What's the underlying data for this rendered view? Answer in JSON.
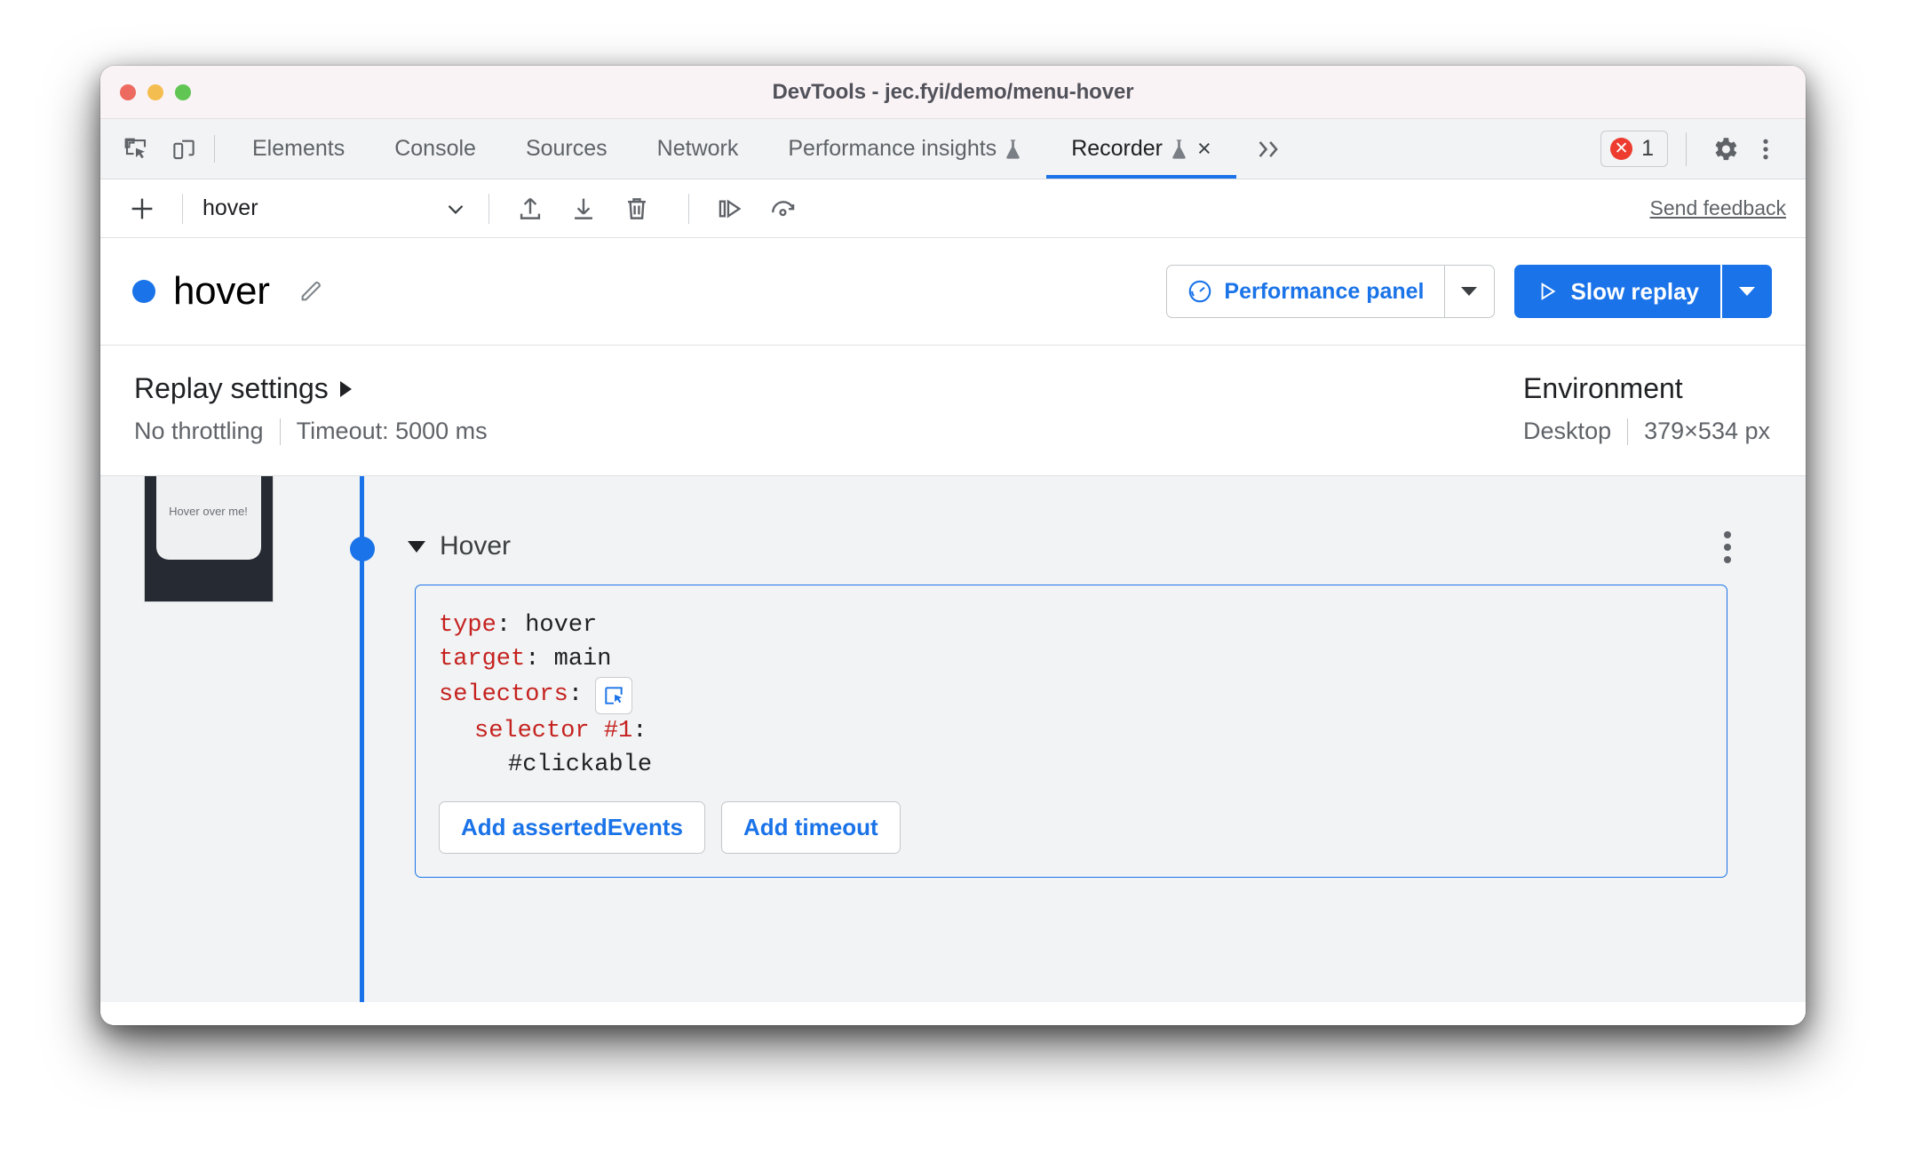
{
  "window": {
    "title": "DevTools - jec.fyi/demo/menu-hover",
    "traffic_lights": [
      "close",
      "minimize",
      "maximize"
    ]
  },
  "tabbar": {
    "left_icons": [
      "inspect-element-icon",
      "device-toolbar-icon"
    ],
    "tabs": [
      {
        "label": "Elements",
        "active": false,
        "experimental": false,
        "closable": false
      },
      {
        "label": "Console",
        "active": false,
        "experimental": false,
        "closable": false
      },
      {
        "label": "Sources",
        "active": false,
        "experimental": false,
        "closable": false
      },
      {
        "label": "Network",
        "active": false,
        "experimental": false,
        "closable": false
      },
      {
        "label": "Performance insights",
        "active": false,
        "experimental": true,
        "closable": false
      },
      {
        "label": "Recorder",
        "active": true,
        "experimental": true,
        "closable": true
      }
    ],
    "more_tabs_label": "»",
    "error_count": "1",
    "right_icons": [
      "settings-gear-icon",
      "kebab-menu-icon"
    ]
  },
  "recorder_toolbar": {
    "add_label": "+",
    "selected_recording": "hover",
    "icons": [
      "import-icon",
      "export-icon",
      "delete-icon",
      "step-over-icon",
      "replay-icon"
    ],
    "feedback_label": "Send feedback"
  },
  "recording_header": {
    "status_color": "#1a73e8",
    "title": "hover",
    "edit_label": "edit-title",
    "performance_button": "Performance panel",
    "replay_button": "Slow replay"
  },
  "settings": {
    "replay_heading": "Replay settings",
    "throttling": "No throttling",
    "timeout": "Timeout: 5000 ms",
    "environment_heading": "Environment",
    "device": "Desktop",
    "viewport": "379×534 px"
  },
  "step": {
    "thumbnail_text": "Hover over me!",
    "title": "Hover",
    "code": {
      "type_key": "type",
      "type_value": "hover",
      "target_key": "target",
      "target_value": "main",
      "selectors_key": "selectors",
      "selector_label": "selector #1",
      "selector_value": "#clickable"
    },
    "add_asserted_events": "Add assertedEvents",
    "add_timeout": "Add timeout"
  },
  "colors": {
    "accent": "#1a73e8",
    "error": "#ee3b2f",
    "code_key": "#c5221f",
    "panel_bg": "#f1f3f4"
  }
}
